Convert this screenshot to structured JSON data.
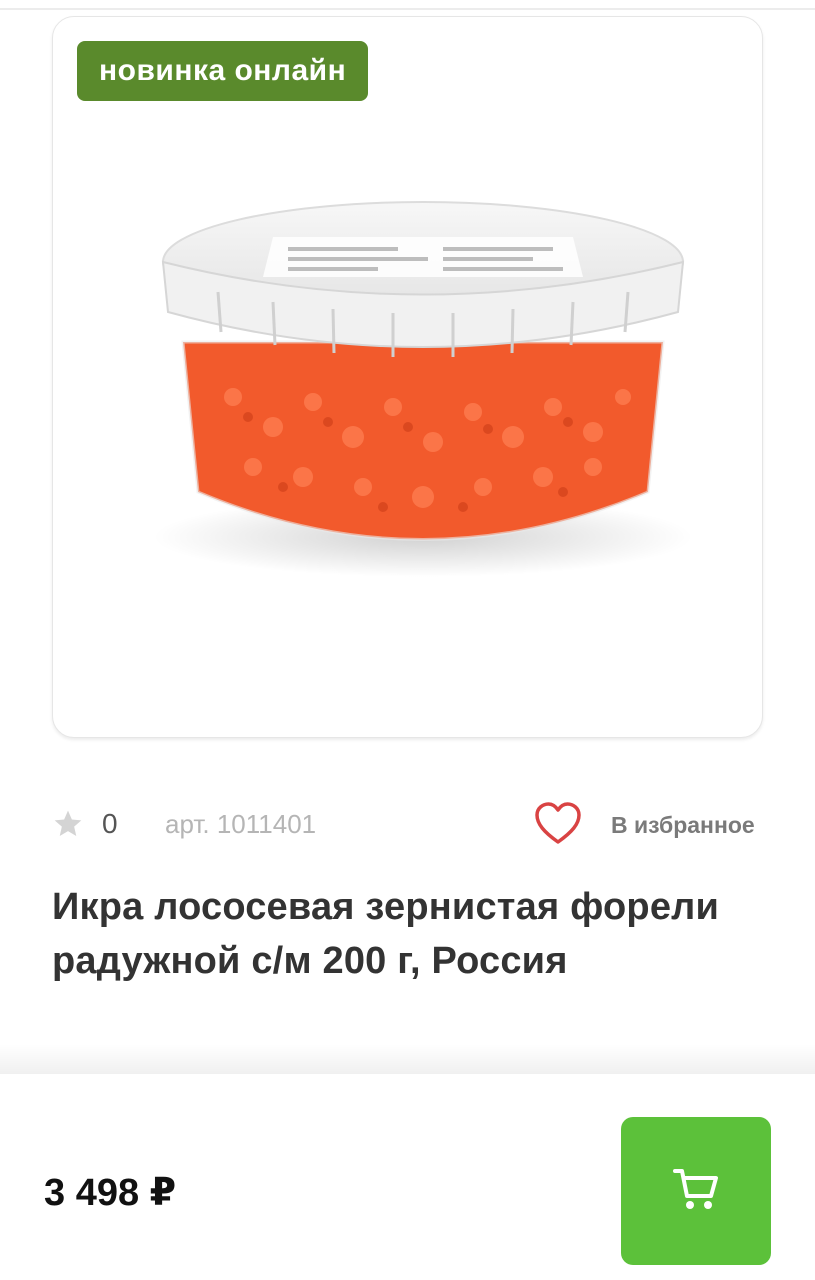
{
  "product": {
    "badge": "новинка онлайн",
    "image_alt": "Икра лососевая в пластиковой банке",
    "rating": "0",
    "article": "арт. 1011401",
    "favorite_label": "В избранное",
    "title": "Икра лососевая зернистая форели радужной с/м 200 г, Россия"
  },
  "purchase": {
    "price": "3 498 ₽"
  },
  "icons": {
    "rating": "star-icon",
    "favorite": "heart-icon",
    "cart": "shopping-cart-icon"
  },
  "colors": {
    "badge": "#5a8a2c",
    "cart_button": "#5cc13a",
    "heart": "#d94343",
    "caviar": "#f25a2c"
  }
}
